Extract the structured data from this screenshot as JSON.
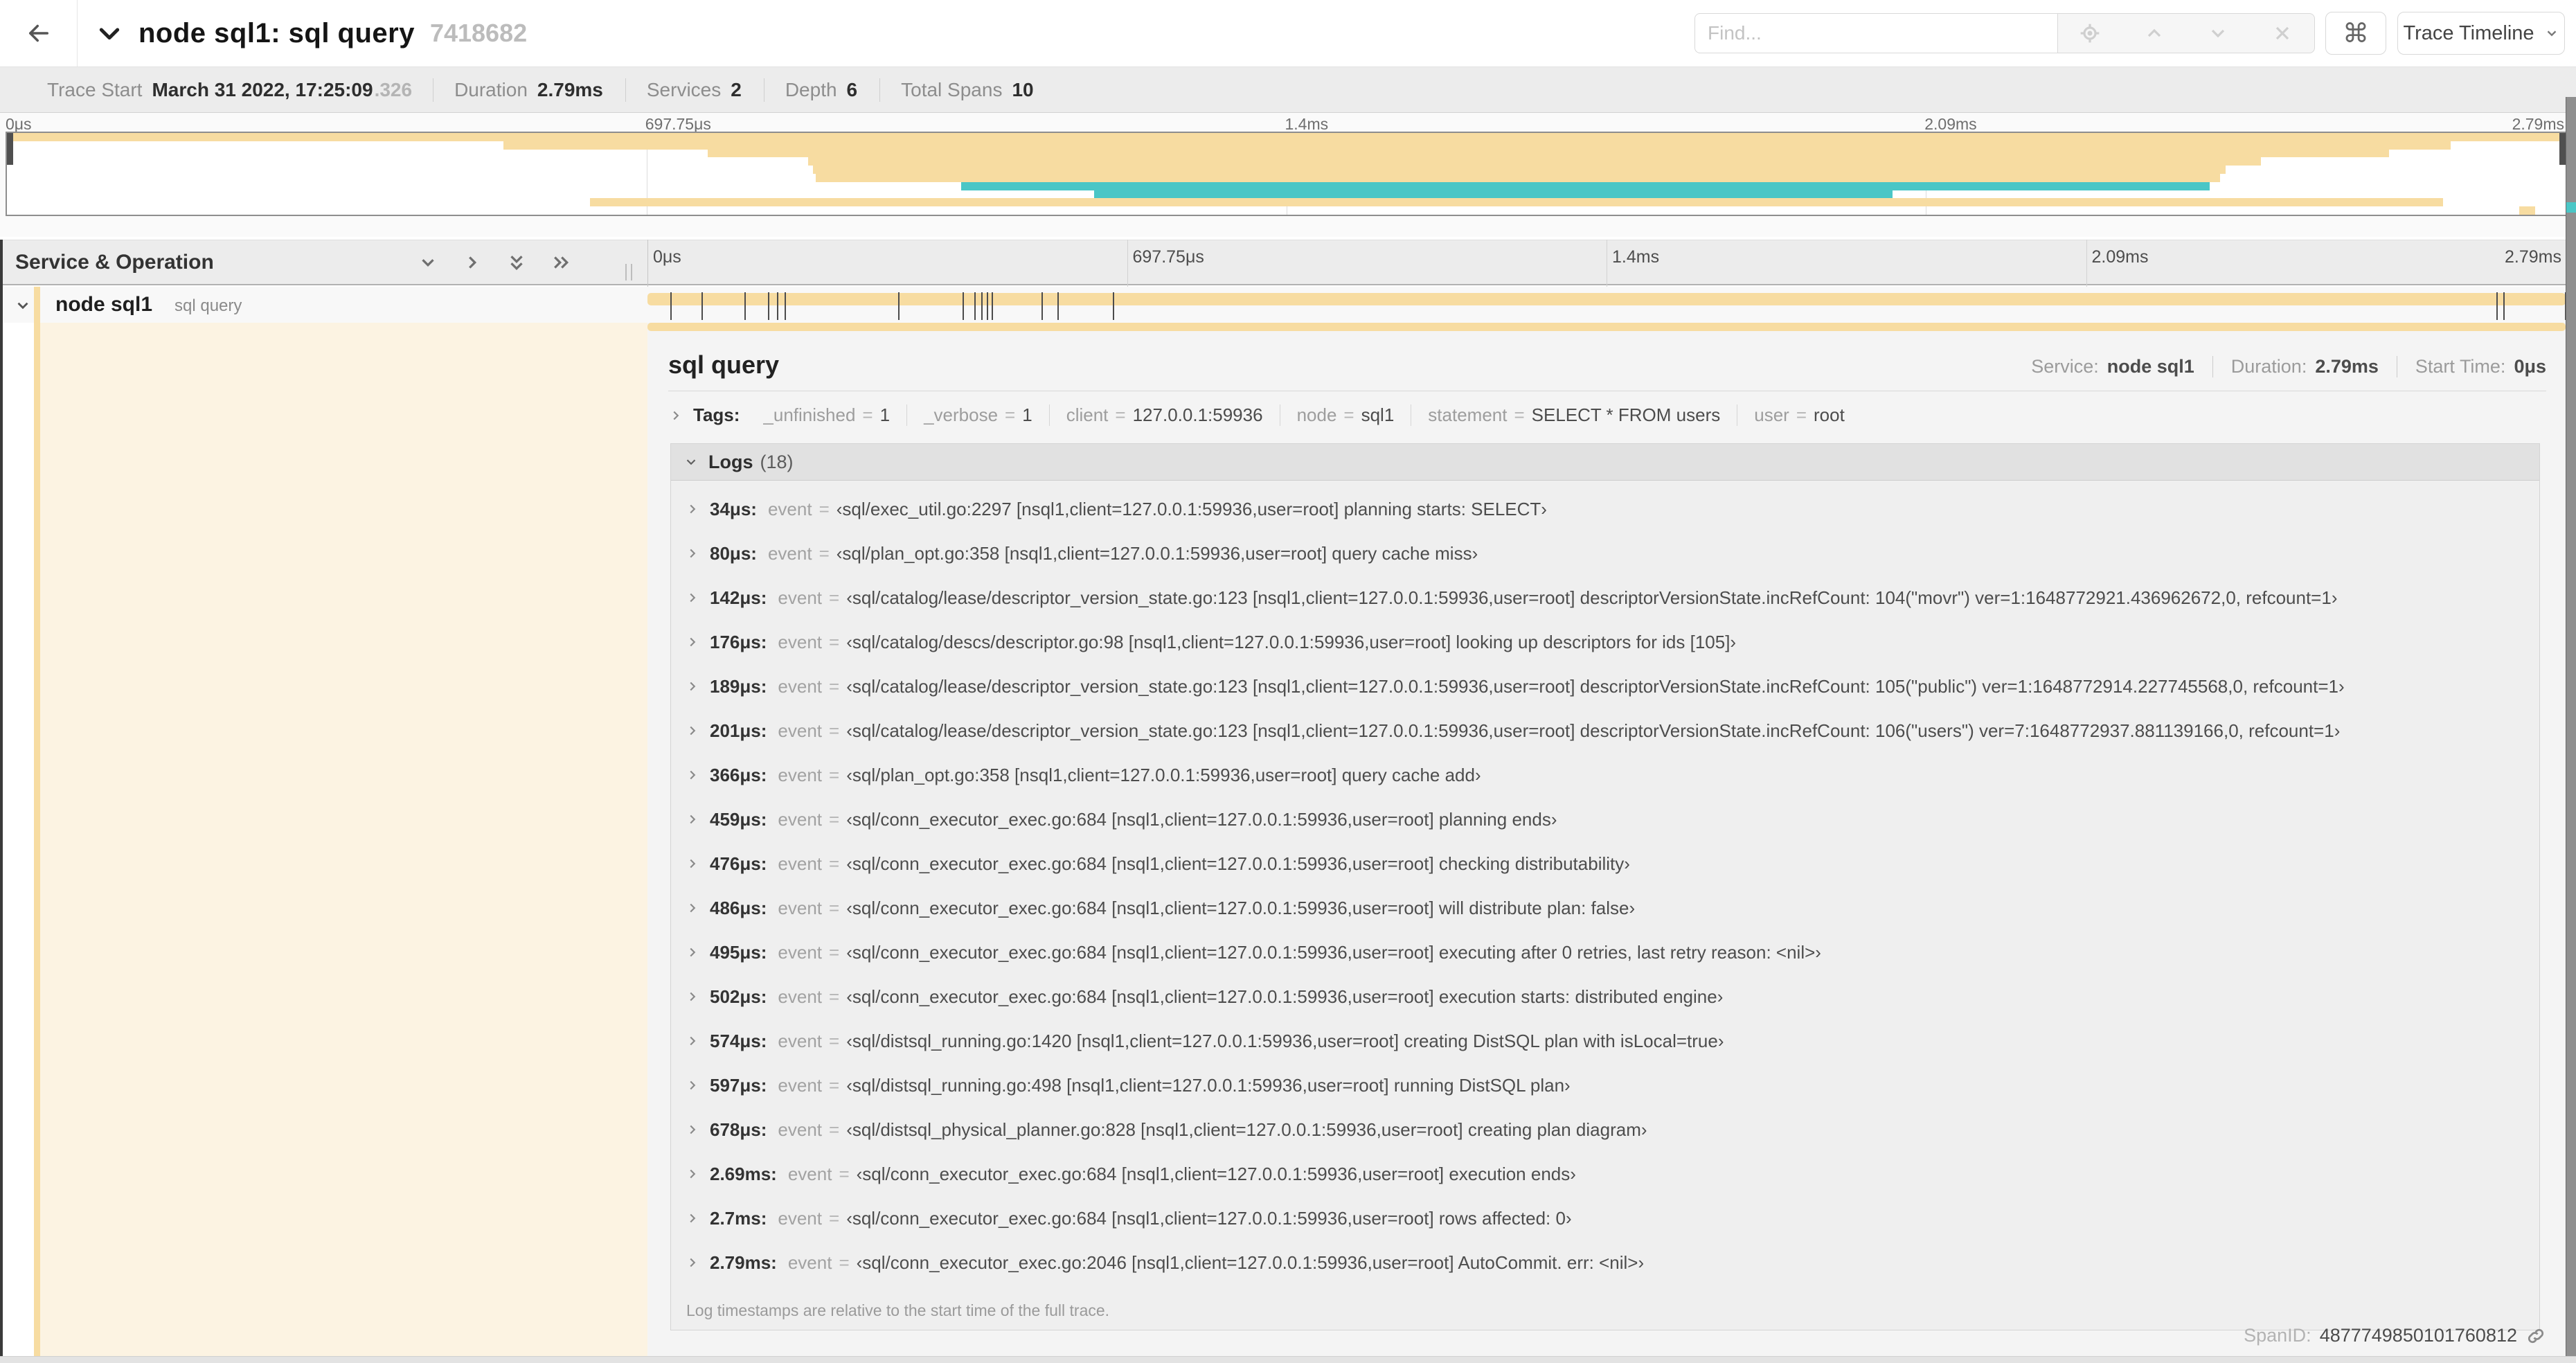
{
  "colors": {
    "tan": "#F7DCA1",
    "teal": "#4AC6C6",
    "cream": "#FCF3E2"
  },
  "header": {
    "title": "node sql1: sql query",
    "trace_id": "7418682",
    "find_placeholder": "Find...",
    "shortcut_label": "⌘",
    "view_selector_label": "Trace Timeline"
  },
  "trace_info": {
    "items": [
      {
        "label": "Trace Start",
        "value": "March 31 2022, 17:25:09",
        "suffix": ".326"
      },
      {
        "label": "Duration",
        "value": "2.79ms"
      },
      {
        "label": "Services",
        "value": "2"
      },
      {
        "label": "Depth",
        "value": "6"
      },
      {
        "label": "Total Spans",
        "value": "10"
      }
    ]
  },
  "minimap": {
    "ticks": [
      {
        "label": "0μs",
        "pct": 0
      },
      {
        "label": "697.75μs",
        "pct": 25
      },
      {
        "label": "1.4ms",
        "pct": 50
      },
      {
        "label": "2.09ms",
        "pct": 75
      },
      {
        "label": "2.79ms",
        "pct": 100
      }
    ],
    "spans": [
      {
        "row": 0,
        "color": "tan",
        "start": 0,
        "end": 100
      },
      {
        "row": 1,
        "color": "tan",
        "start": 19.4,
        "end": 95.5
      },
      {
        "row": 2,
        "color": "tan",
        "start": 27.4,
        "end": 93.1
      },
      {
        "row": 3,
        "color": "tan",
        "start": 31.3,
        "end": 88.1
      },
      {
        "row": 4,
        "color": "tan",
        "start": 31.5,
        "end": 86.7
      },
      {
        "row": 5,
        "color": "tan",
        "start": 31.6,
        "end": 86.5
      },
      {
        "row": 6,
        "color": "teal",
        "start": 37.3,
        "end": 86.1
      },
      {
        "row": 7,
        "color": "teal",
        "start": 42.5,
        "end": 73.7
      },
      {
        "row": 8,
        "color": "tan",
        "start": 22.8,
        "end": 95.2
      },
      {
        "row": 9,
        "color": "tan",
        "start": 98.2,
        "end": 98.8
      }
    ]
  },
  "timeline": {
    "header_label": "Service & Operation",
    "ticks": [
      {
        "label": "0μs",
        "pct": 0
      },
      {
        "label": "697.75μs",
        "pct": 25
      },
      {
        "label": "1.4ms",
        "pct": 50
      },
      {
        "label": "2.09ms",
        "pct": 75
      },
      {
        "label": "2.79ms",
        "pct": 100
      }
    ],
    "row": {
      "service": "node sql1",
      "operation": "sql query"
    },
    "log_marks_pct": [
      1.22,
      2.87,
      5.09,
      6.31,
      6.77,
      7.2,
      13.12,
      16.45,
      17.06,
      17.42,
      17.74,
      17.99,
      20.57,
      21.4,
      24.3,
      96.42,
      96.77,
      100
    ]
  },
  "detail": {
    "operation": "sql query",
    "eq": "=",
    "overview": [
      {
        "label": "Service:",
        "value": "node sql1"
      },
      {
        "label": "Duration:",
        "value": "2.79ms"
      },
      {
        "label": "Start Time:",
        "value": "0μs"
      }
    ],
    "tags_label": "Tags:",
    "tags": [
      {
        "key": "_unfinished",
        "value": "1"
      },
      {
        "key": "_verbose",
        "value": "1"
      },
      {
        "key": "client",
        "value": "127.0.0.1:59936"
      },
      {
        "key": "node",
        "value": "sql1"
      },
      {
        "key": "statement",
        "value": "SELECT * FROM users"
      },
      {
        "key": "user",
        "value": "root"
      }
    ],
    "logs_label": "Logs",
    "logs_count": "(18)",
    "logs": [
      {
        "t": "34μs:",
        "k": "event",
        "v": "‹sql/exec_util.go:2297 [nsql1,client=127.0.0.1:59936,user=root] planning starts: SELECT›"
      },
      {
        "t": "80μs:",
        "k": "event",
        "v": "‹sql/plan_opt.go:358 [nsql1,client=127.0.0.1:59936,user=root] query cache miss›"
      },
      {
        "t": "142μs:",
        "k": "event",
        "v": "‹sql/catalog/lease/descriptor_version_state.go:123 [nsql1,client=127.0.0.1:59936,user=root] descriptorVersionState.incRefCount: 104(\"movr\") ver=1:1648772921.436962672,0, refcount=1›"
      },
      {
        "t": "176μs:",
        "k": "event",
        "v": "‹sql/catalog/descs/descriptor.go:98 [nsql1,client=127.0.0.1:59936,user=root] looking up descriptors for ids [105]›"
      },
      {
        "t": "189μs:",
        "k": "event",
        "v": "‹sql/catalog/lease/descriptor_version_state.go:123 [nsql1,client=127.0.0.1:59936,user=root] descriptorVersionState.incRefCount: 105(\"public\") ver=1:1648772914.227745568,0, refcount=1›"
      },
      {
        "t": "201μs:",
        "k": "event",
        "v": "‹sql/catalog/lease/descriptor_version_state.go:123 [nsql1,client=127.0.0.1:59936,user=root] descriptorVersionState.incRefCount: 106(\"users\") ver=7:1648772937.881139166,0, refcount=1›"
      },
      {
        "t": "366μs:",
        "k": "event",
        "v": "‹sql/plan_opt.go:358 [nsql1,client=127.0.0.1:59936,user=root] query cache add›"
      },
      {
        "t": "459μs:",
        "k": "event",
        "v": "‹sql/conn_executor_exec.go:684 [nsql1,client=127.0.0.1:59936,user=root] planning ends›"
      },
      {
        "t": "476μs:",
        "k": "event",
        "v": "‹sql/conn_executor_exec.go:684 [nsql1,client=127.0.0.1:59936,user=root] checking distributability›"
      },
      {
        "t": "486μs:",
        "k": "event",
        "v": "‹sql/conn_executor_exec.go:684 [nsql1,client=127.0.0.1:59936,user=root] will distribute plan: false›"
      },
      {
        "t": "495μs:",
        "k": "event",
        "v": "‹sql/conn_executor_exec.go:684 [nsql1,client=127.0.0.1:59936,user=root] executing after 0 retries, last retry reason: <nil>›"
      },
      {
        "t": "502μs:",
        "k": "event",
        "v": "‹sql/conn_executor_exec.go:684 [nsql1,client=127.0.0.1:59936,user=root] execution starts: distributed engine›"
      },
      {
        "t": "574μs:",
        "k": "event",
        "v": "‹sql/distsql_running.go:1420 [nsql1,client=127.0.0.1:59936,user=root] creating DistSQL plan with isLocal=true›"
      },
      {
        "t": "597μs:",
        "k": "event",
        "v": "‹sql/distsql_running.go:498 [nsql1,client=127.0.0.1:59936,user=root] running DistSQL plan›"
      },
      {
        "t": "678μs:",
        "k": "event",
        "v": "‹sql/distsql_physical_planner.go:828 [nsql1,client=127.0.0.1:59936,user=root] creating plan diagram›"
      },
      {
        "t": "2.69ms:",
        "k": "event",
        "v": "‹sql/conn_executor_exec.go:684 [nsql1,client=127.0.0.1:59936,user=root] execution ends›"
      },
      {
        "t": "2.7ms:",
        "k": "event",
        "v": "‹sql/conn_executor_exec.go:684 [nsql1,client=127.0.0.1:59936,user=root] rows affected: 0›"
      },
      {
        "t": "2.79ms:",
        "k": "event",
        "v": "‹sql/conn_executor_exec.go:2046 [nsql1,client=127.0.0.1:59936,user=root] AutoCommit. err: <nil>›"
      }
    ],
    "note": "Log timestamps are relative to the start time of the full trace.",
    "span_id_label": "SpanID:",
    "span_id": "4877749850101760812"
  }
}
